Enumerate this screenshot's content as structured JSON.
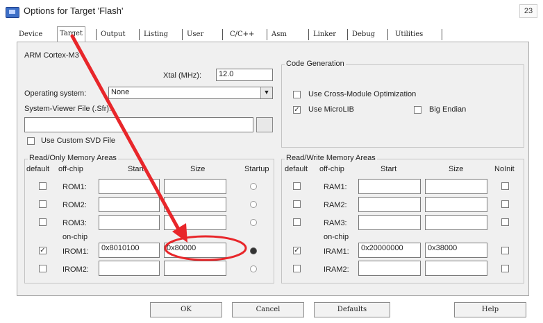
{
  "window": {
    "title": "Options for Target 'Flash'",
    "close_label": "23"
  },
  "tabs": [
    {
      "label": "Device"
    },
    {
      "label": "Target"
    },
    {
      "label": "Output"
    },
    {
      "label": "Listing"
    },
    {
      "label": "User"
    },
    {
      "label": "C/C++"
    },
    {
      "label": "Asm"
    },
    {
      "label": "Linker"
    },
    {
      "label": "Debug"
    },
    {
      "label": "Utilities"
    }
  ],
  "target": {
    "cpu": "ARM Cortex-M3",
    "xtal_label": "Xtal (MHz):",
    "xtal_value": "12.0",
    "os_label": "Operating system:",
    "os_value": "None",
    "svd_label": "System-Viewer File (.Sfr):",
    "svd_value": "",
    "custom_svd_label": "Use Custom SVD File"
  },
  "codegen": {
    "title": "Code Generation",
    "cross_module": "Use Cross-Module Optimization",
    "microlib": "Use MicroLIB",
    "big_endian": "Big Endian",
    "cross_module_checked": false,
    "microlib_checked": true,
    "big_endian_checked": false
  },
  "rom": {
    "title": "Read/Only Memory Areas",
    "headers": {
      "default": "default",
      "offchip": "off-chip",
      "start": "Start",
      "size": "Size",
      "startup": "Startup"
    },
    "onchip_label": "on-chip",
    "rows": [
      {
        "name": "ROM1:",
        "start": "",
        "size": "",
        "default": false,
        "startup": false
      },
      {
        "name": "ROM2:",
        "start": "",
        "size": "",
        "default": false,
        "startup": false
      },
      {
        "name": "ROM3:",
        "start": "",
        "size": "",
        "default": false,
        "startup": false
      },
      {
        "name": "IROM1:",
        "start": "0x8010100",
        "size": "0x80000",
        "default": true,
        "startup": true
      },
      {
        "name": "IROM2:",
        "start": "",
        "size": "",
        "default": false,
        "startup": false
      }
    ]
  },
  "ram": {
    "title": "Read/Write Memory Areas",
    "headers": {
      "default": "default",
      "offchip": "off-chip",
      "start": "Start",
      "size": "Size",
      "noinit": "NoInit"
    },
    "onchip_label": "on-chip",
    "rows": [
      {
        "name": "RAM1:",
        "start": "",
        "size": "",
        "default": false,
        "noinit": false
      },
      {
        "name": "RAM2:",
        "start": "",
        "size": "",
        "default": false,
        "noinit": false
      },
      {
        "name": "RAM3:",
        "start": "",
        "size": "",
        "default": false,
        "noinit": false
      },
      {
        "name": "IRAM1:",
        "start": "0x20000000",
        "size": "0x38000",
        "default": true,
        "noinit": false
      },
      {
        "name": "IRAM2:",
        "start": "",
        "size": "",
        "default": false,
        "noinit": false
      }
    ]
  },
  "buttons": {
    "ok": "OK",
    "cancel": "Cancel",
    "defaults": "Defaults",
    "help": "Help"
  },
  "annotation": {
    "color": "#e8262a"
  }
}
